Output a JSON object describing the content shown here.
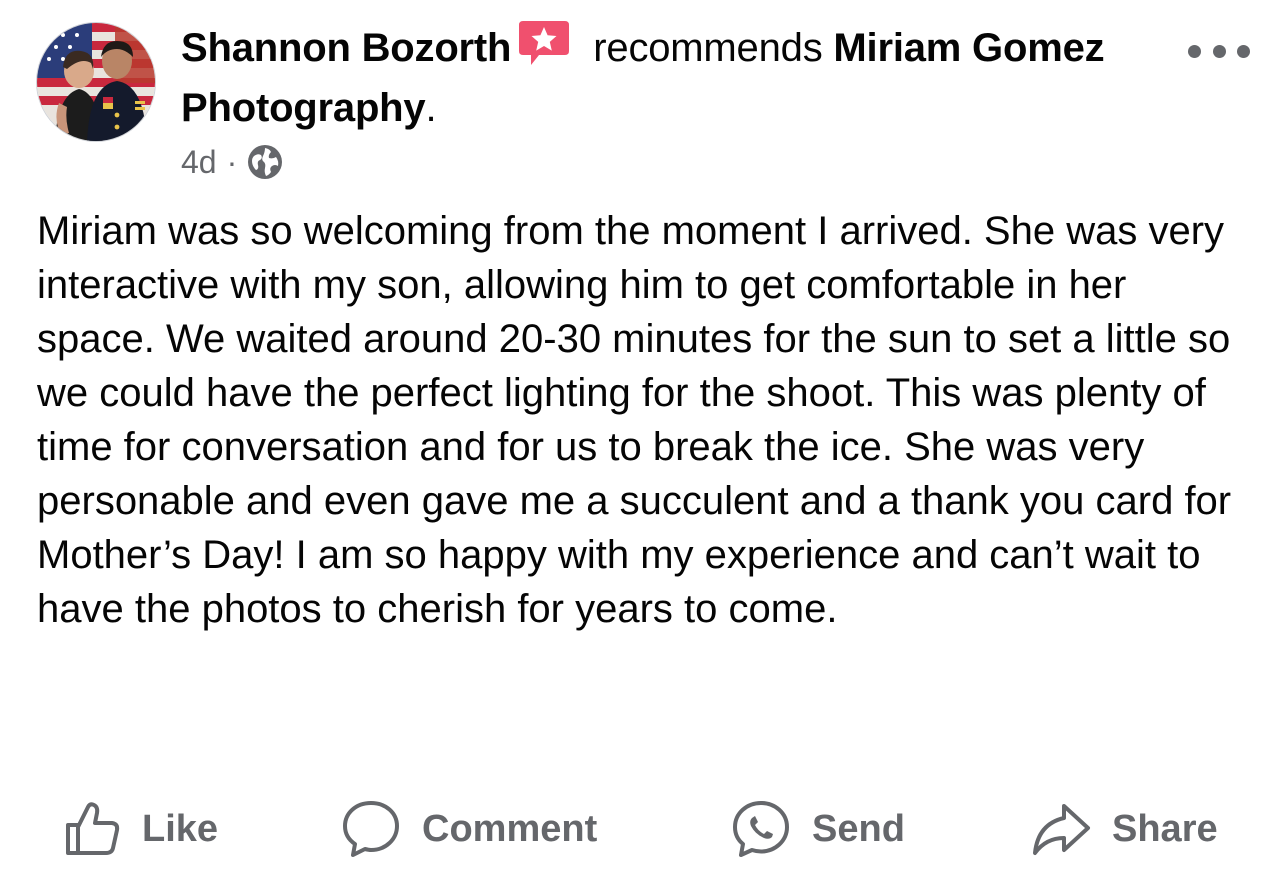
{
  "post": {
    "author": "Shannon Bozorth",
    "verb": "recommends",
    "page_name": "Miriam Gomez Photography",
    "page_name_suffix": ".",
    "timestamp": "4d",
    "separator": "·",
    "audience_icon": "globe-icon",
    "badge_icon": "recommend-star-icon",
    "more_icon": "ellipsis-icon",
    "text": "Miriam was so welcoming from the moment I arrived. She was very interactive with my son, allowing him to get comfortable in her space. We waited around 20-30 minutes for the sun to set a little so we could have the perfect lighting for the shoot. This was plenty of time for conversation and for us to break the ice. She was very personable and even gave me a succulent and a thank you card for Mother’s Day! I am so happy with my experience and can’t wait to have the photos to cherish for years to come."
  },
  "actions": [
    {
      "label": "Like",
      "icon": "thumbs-up-icon"
    },
    {
      "label": "Comment",
      "icon": "comment-icon"
    },
    {
      "label": "Send",
      "icon": "messenger-icon"
    },
    {
      "label": "Share",
      "icon": "share-arrow-icon"
    }
  ],
  "colors": {
    "text_primary": "#050505",
    "text_secondary": "#65676b",
    "badge": "#f0506e"
  }
}
